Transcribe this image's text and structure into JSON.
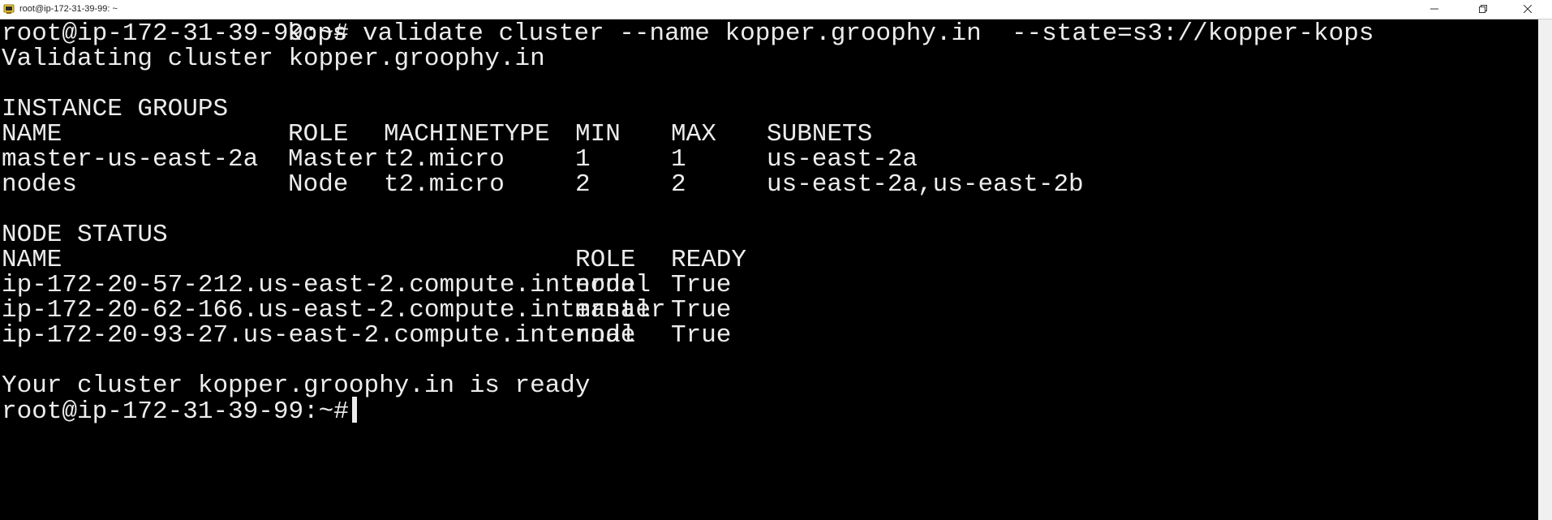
{
  "window": {
    "title": "root@ip-172-31-39-99: ~",
    "icon": "putty-terminal-icon"
  },
  "terminal": {
    "prompt": "root@ip-172-31-39-99:~#",
    "command": "kops validate cluster --name kopper.groophy.in  --state=s3://kopper-kops",
    "validating": "Validating cluster kopper.groophy.in",
    "instance_groups": {
      "heading": "INSTANCE GROUPS",
      "columns": [
        "NAME",
        "ROLE",
        "MACHINETYPE",
        "MIN",
        "MAX",
        "SUBNETS"
      ],
      "rows": [
        [
          "master-us-east-2a",
          "Master",
          "t2.micro",
          "1",
          "1",
          "us-east-2a"
        ],
        [
          "nodes",
          "Node",
          "t2.micro",
          "2",
          "2",
          "us-east-2a,us-east-2b"
        ]
      ]
    },
    "node_status": {
      "heading": "NODE STATUS",
      "columns": [
        "NAME",
        "ROLE",
        "READY"
      ],
      "rows": [
        [
          "ip-172-20-57-212.us-east-2.compute.internal",
          "node",
          "True"
        ],
        [
          "ip-172-20-62-166.us-east-2.compute.internal",
          "master",
          "True"
        ],
        [
          "ip-172-20-93-27.us-east-2.compute.internal",
          "node",
          "True"
        ]
      ]
    },
    "ready_message": "Your cluster kopper.groophy.in is ready",
    "final_prompt": "root@ip-172-31-39-99:~#"
  },
  "colors": {
    "background": "#000000",
    "foreground": "#ececec"
  }
}
